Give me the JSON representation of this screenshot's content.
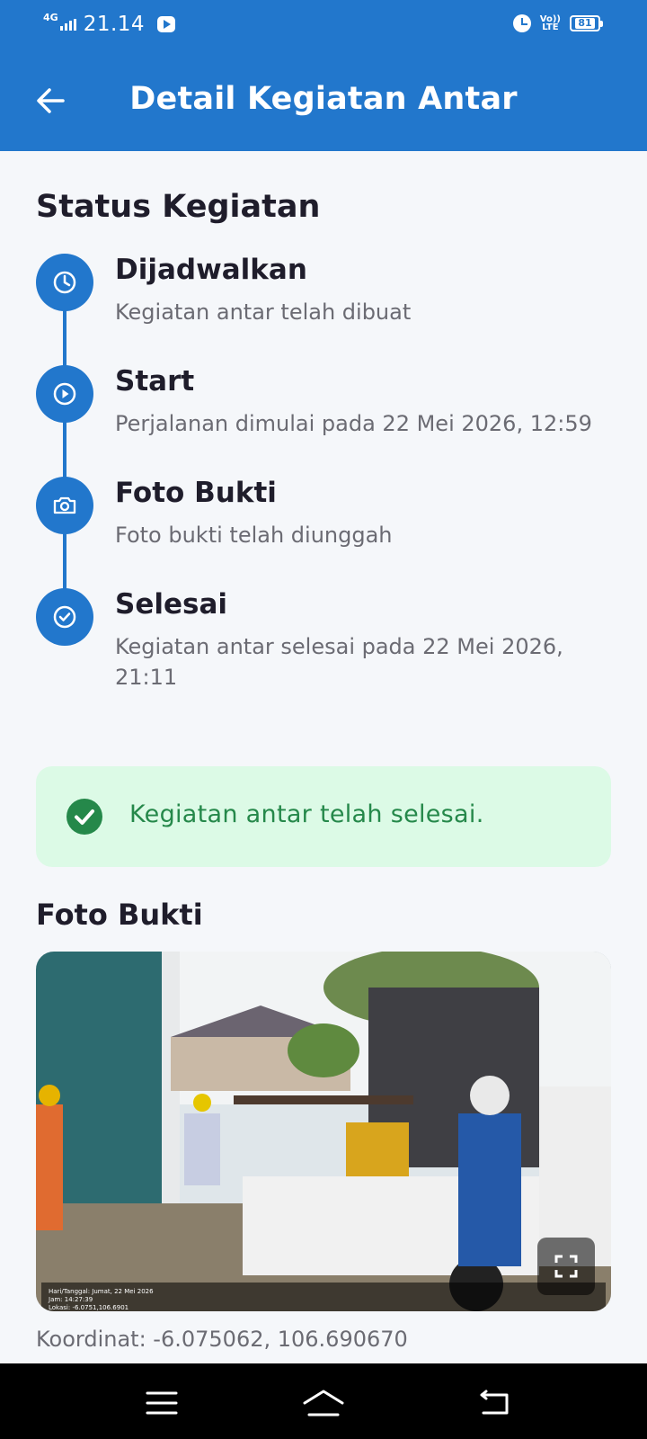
{
  "status_bar": {
    "network": "4G",
    "time": "21.14",
    "volte_top": "Vo))",
    "volte_bottom": "LTE",
    "battery": "81"
  },
  "app_bar": {
    "title": "Detail Kegiatan Antar",
    "back_icon": "arrow-left-icon"
  },
  "status_section": {
    "title": "Status Kegiatan",
    "steps": [
      {
        "icon": "clock-icon",
        "title": "Dijadwalkan",
        "desc": "Kegiatan antar telah dibuat"
      },
      {
        "icon": "play-circle-icon",
        "title": "Start",
        "desc": "Perjalanan dimulai pada 22 Mei 2026, 12:59"
      },
      {
        "icon": "camera-icon",
        "title": "Foto Bukti",
        "desc": "Foto bukti telah diunggah"
      },
      {
        "icon": "check-circle-icon",
        "title": "Selesai",
        "desc": "Kegiatan antar selesai pada 22 Mei 2026, 21:11"
      }
    ]
  },
  "success_banner": {
    "icon": "check-circle-filled-icon",
    "text": "Kegiatan antar telah selesai.",
    "color": "#25884a",
    "background": "#dcfae6"
  },
  "photo_section": {
    "title": "Foto Bukti",
    "stamp_lines": [
      "Hari/Tanggal: Jumat, 22 Mei 2026",
      "Jam: 14:27:39",
      "Lokasi: -6.0751,106.6901"
    ],
    "expand_icon": "fullscreen-icon",
    "coordinates": "Koordinat: -6.075062, 106.690670"
  },
  "nav_bar": {
    "menu_icon": "menu-icon",
    "home_icon": "home-icon",
    "back_icon": "back-icon"
  },
  "colors": {
    "primary": "#2277cc",
    "text_dark": "#1f1d2b",
    "text_muted": "#6b6b73"
  }
}
